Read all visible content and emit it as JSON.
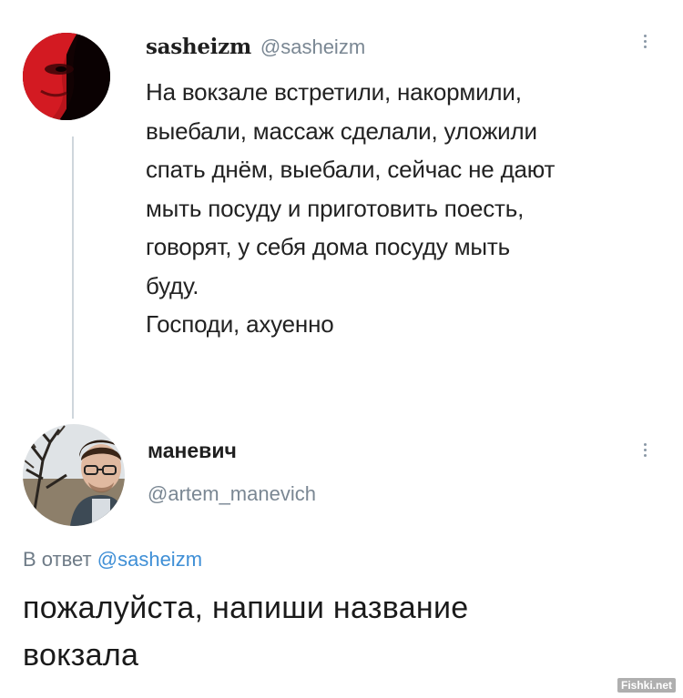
{
  "tweet": {
    "author": {
      "display_name": "sasheizm",
      "handle": "@sasheizm",
      "avatar_icon": "red-tinted-face-avatar"
    },
    "lines": [
      "На вокзале встретили, накормили,",
      "выебали, массаж сделали, уложили",
      "спать днём, выебали, сейчас не дают",
      "мыть посуду и приготовить поесть,",
      "говорят, у себя дома посуду мыть",
      "буду.",
      "Господи, ахуенно"
    ]
  },
  "reply": {
    "author": {
      "display_name": "маневич",
      "handle": "@artem_manevich",
      "avatar_icon": "man-with-glasses-avatar"
    },
    "reply_to_prefix": "В ответ",
    "reply_to_mention": "@sasheizm",
    "lines": [
      "пожалуйста, напиши название",
      "вокзала"
    ]
  },
  "watermark": "Fishki.net",
  "colors": {
    "handle_gray": "#7a8793",
    "mention_blue": "#3f8fd6",
    "thread_line": "#cfd6dc",
    "avatar_red": "#c0141c"
  }
}
